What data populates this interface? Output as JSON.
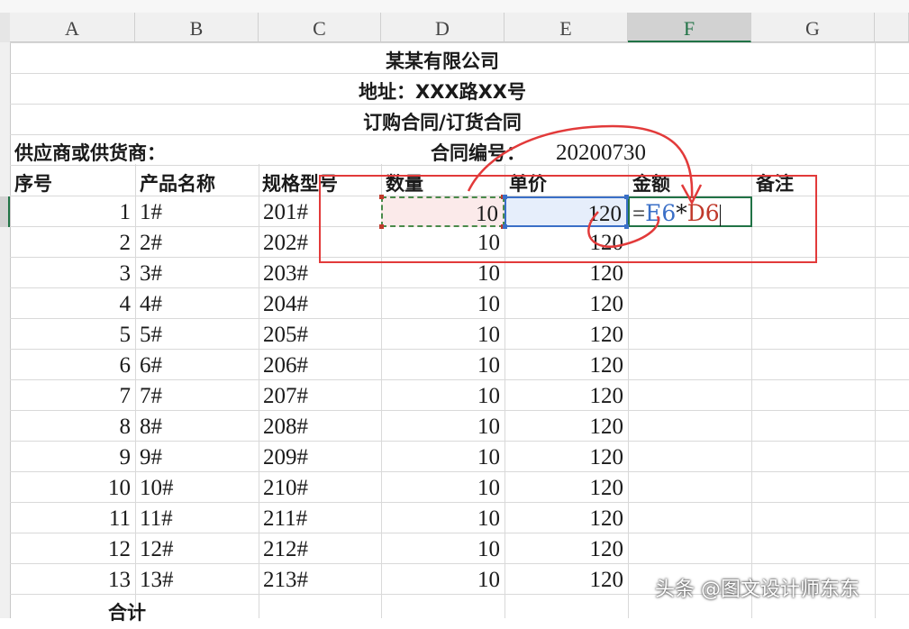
{
  "columns": [
    "A",
    "B",
    "C",
    "D",
    "E",
    "F",
    "G"
  ],
  "header": {
    "company": "某某有限公司",
    "address": "地址：XXX路XX号",
    "doc_title": "订购合同/订货合同",
    "supplier_label": "供应商或供货商：",
    "contract_label": "合同编号：",
    "contract_no": "20200730"
  },
  "table_headers": [
    "序号",
    "产品名称",
    "规格型号",
    "数量",
    "单价",
    "金额",
    "备注"
  ],
  "rows": [
    {
      "seq": "1",
      "name": "1#",
      "spec": "201#",
      "qty": "10",
      "price": "120"
    },
    {
      "seq": "2",
      "name": "2#",
      "spec": "202#",
      "qty": "10",
      "price": "120"
    },
    {
      "seq": "3",
      "name": "3#",
      "spec": "203#",
      "qty": "10",
      "price": "120"
    },
    {
      "seq": "4",
      "name": "4#",
      "spec": "204#",
      "qty": "10",
      "price": "120"
    },
    {
      "seq": "5",
      "name": "5#",
      "spec": "205#",
      "qty": "10",
      "price": "120"
    },
    {
      "seq": "6",
      "name": "6#",
      "spec": "206#",
      "qty": "10",
      "price": "120"
    },
    {
      "seq": "7",
      "name": "7#",
      "spec": "207#",
      "qty": "10",
      "price": "120"
    },
    {
      "seq": "8",
      "name": "8#",
      "spec": "208#",
      "qty": "10",
      "price": "120"
    },
    {
      "seq": "9",
      "name": "9#",
      "spec": "209#",
      "qty": "10",
      "price": "120"
    },
    {
      "seq": "10",
      "name": "10#",
      "spec": "210#",
      "qty": "10",
      "price": "120"
    },
    {
      "seq": "11",
      "name": "11#",
      "spec": "211#",
      "qty": "10",
      "price": "120"
    },
    {
      "seq": "12",
      "name": "12#",
      "spec": "212#",
      "qty": "10",
      "price": "120"
    },
    {
      "seq": "13",
      "name": "13#",
      "spec": "213#",
      "qty": "10",
      "price": "120"
    }
  ],
  "formula": {
    "eq": "=",
    "ref1": "E6",
    "op": "*",
    "ref2": "D6"
  },
  "total_label": "合计",
  "watermark": "头条 @图文设计师东东",
  "colors": {
    "accent": "#217346",
    "annotation": "#e23a3a",
    "ref_blue": "#3a6fc7",
    "ref_red": "#c0392b"
  }
}
